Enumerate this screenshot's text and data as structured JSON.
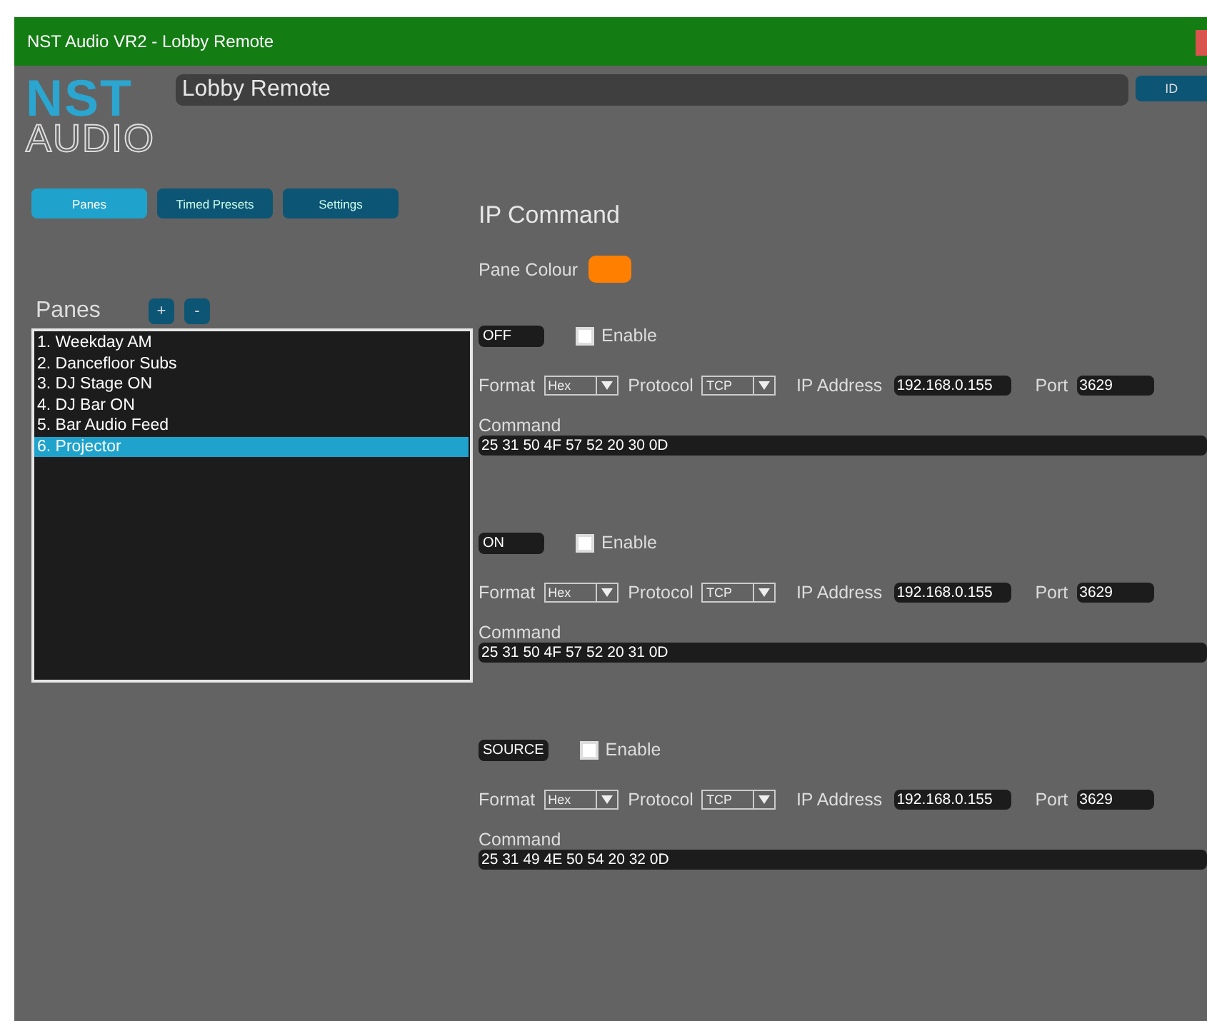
{
  "window": {
    "title": "NST Audio VR2 - Lobby Remote"
  },
  "logo": {
    "line1": "NST",
    "line2": "AUDIO"
  },
  "name_field": {
    "value": "Lobby Remote"
  },
  "id_button": {
    "label": "ID"
  },
  "tabs": [
    {
      "label": "Panes",
      "selected": true
    },
    {
      "label": "Timed Presets",
      "selected": false
    },
    {
      "label": "Settings",
      "selected": false
    }
  ],
  "panes": {
    "label": "Panes",
    "add": "+",
    "remove": "-",
    "items": [
      {
        "label": "1. Weekday AM",
        "selected": false
      },
      {
        "label": "2. Dancefloor Subs",
        "selected": false
      },
      {
        "label": "3. DJ Stage ON",
        "selected": false
      },
      {
        "label": "4. DJ Bar ON",
        "selected": false
      },
      {
        "label": "5. Bar Audio Feed",
        "selected": false
      },
      {
        "label": "6. Projector",
        "selected": true
      }
    ]
  },
  "editor": {
    "title": "IP Command",
    "colour_label": "Pane Colour",
    "color": "#ff8000",
    "commands": [
      {
        "name": "OFF",
        "enable_label": "Enable",
        "checked": false,
        "format_label": "Format",
        "format": "Hex",
        "protocol_label": "Protocol",
        "protocol": "TCP",
        "ip_label": "IP Address",
        "ip": "192.168.0.155",
        "port_label": "Port",
        "port": "3629",
        "command_label": "Command",
        "command": "25 31 50 4F 57 52 20 30 0D"
      },
      {
        "name": "ON",
        "enable_label": "Enable",
        "checked": false,
        "format_label": "Format",
        "format": "Hex",
        "protocol_label": "Protocol",
        "protocol": "TCP",
        "ip_label": "IP Address",
        "ip": "192.168.0.155",
        "port_label": "Port",
        "port": "3629",
        "command_label": "Command",
        "command": "25 31 50 4F 57 52 20 31 0D"
      },
      {
        "name": "SOURCE",
        "enable_label": "Enable",
        "checked": false,
        "format_label": "Format",
        "format": "Hex",
        "protocol_label": "Protocol",
        "protocol": "TCP",
        "ip_label": "IP Address",
        "ip": "192.168.0.155",
        "port_label": "Port",
        "port": "3629",
        "command_label": "Command",
        "command": "25 31 49 4E 50 54 20 32 0D"
      }
    ]
  }
}
